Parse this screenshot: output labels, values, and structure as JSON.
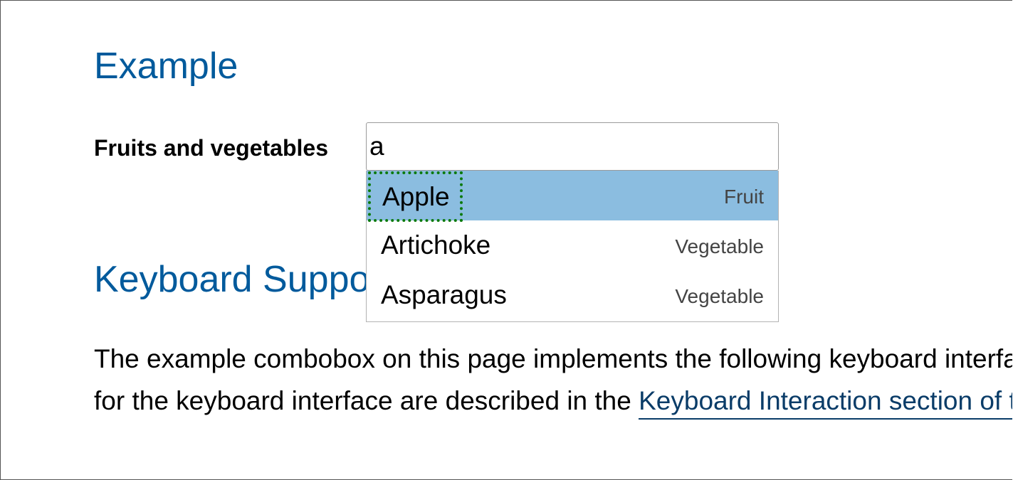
{
  "colors": {
    "heading": "#005a9c",
    "link": "#0a3c68",
    "selected_option_bg": "#8bbde0",
    "focus_outline": "#0c7a0c",
    "text": "#000000",
    "secondary_text": "#444444"
  },
  "example_heading": "Example",
  "combobox": {
    "label": "Fruits and vegetables",
    "value": "a",
    "options": [
      {
        "name": "Apple",
        "kind": "Fruit",
        "selected": true
      },
      {
        "name": "Artichoke",
        "kind": "Vegetable",
        "selected": false
      },
      {
        "name": "Asparagus",
        "kind": "Vegetable",
        "selected": false
      }
    ]
  },
  "keyboard_heading": "Keyboard Support",
  "body": {
    "line1": "The example combobox on this page implements the following keyboard interface. Other variations and options",
    "line2_prefix": "for the keyboard interface are described in the ",
    "link_text": "Keyboard Interaction section of the combobox design pattern."
  }
}
